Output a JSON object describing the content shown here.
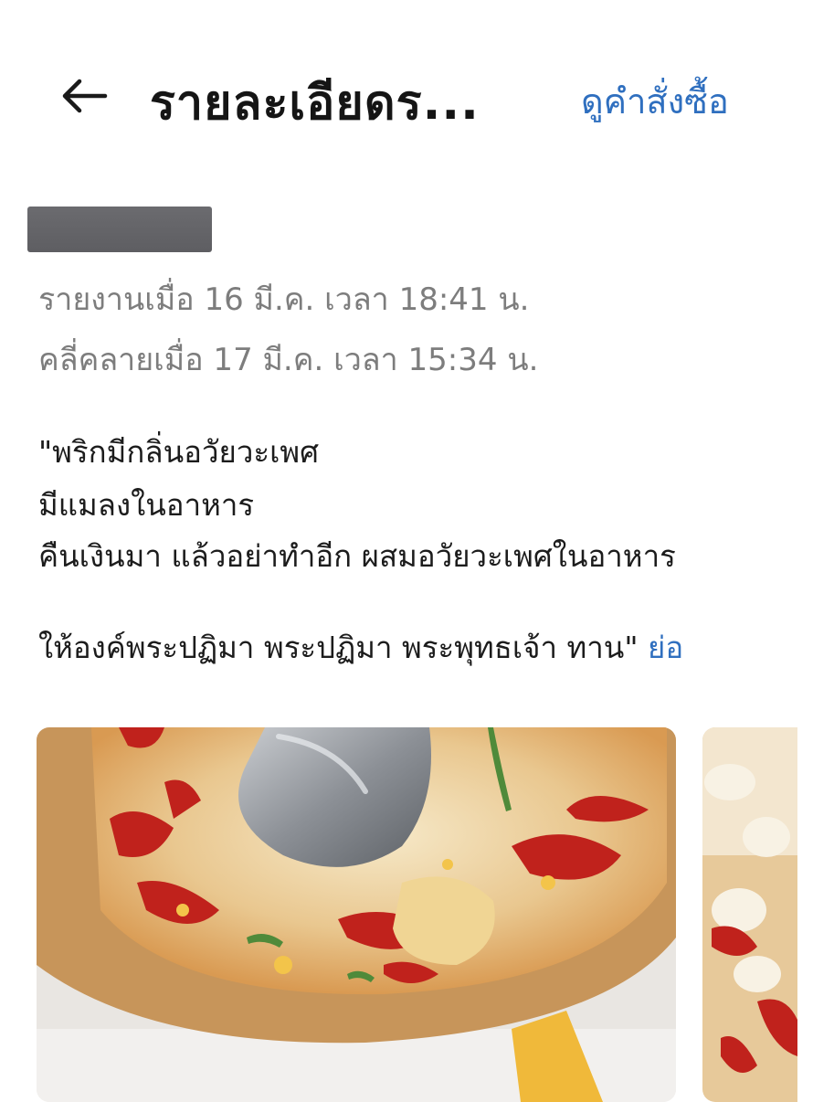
{
  "header": {
    "back_icon": "arrow-left-icon",
    "title": "รายละเอียดร...",
    "view_order_label": "ดูคำสั่งซื้อ"
  },
  "report": {
    "reported_at": "รายงานเมื่อ 16 มี.ค. เวลา 18:41 น.",
    "resolved_at": "คลี่คลายเมื่อ 17 มี.ค. เวลา 15:34 น.",
    "comment_lines": [
      "\"พริกมีกลิ่นอวัยวะเพศ",
      "มีแมลงในอาหาร",
      "คืนเงินมา แล้วอย่าทำอีก ผสมอวัยวะเพศในอาหาร",
      "ให้องค์พระปฏิมา พระปฏิมา พระพุทธเจ้า ทาน\""
    ],
    "collapse_label": "ย่อ"
  },
  "colors": {
    "link": "#2f6fbf",
    "meta_text": "#7d7d7d",
    "title_text": "#151515"
  }
}
